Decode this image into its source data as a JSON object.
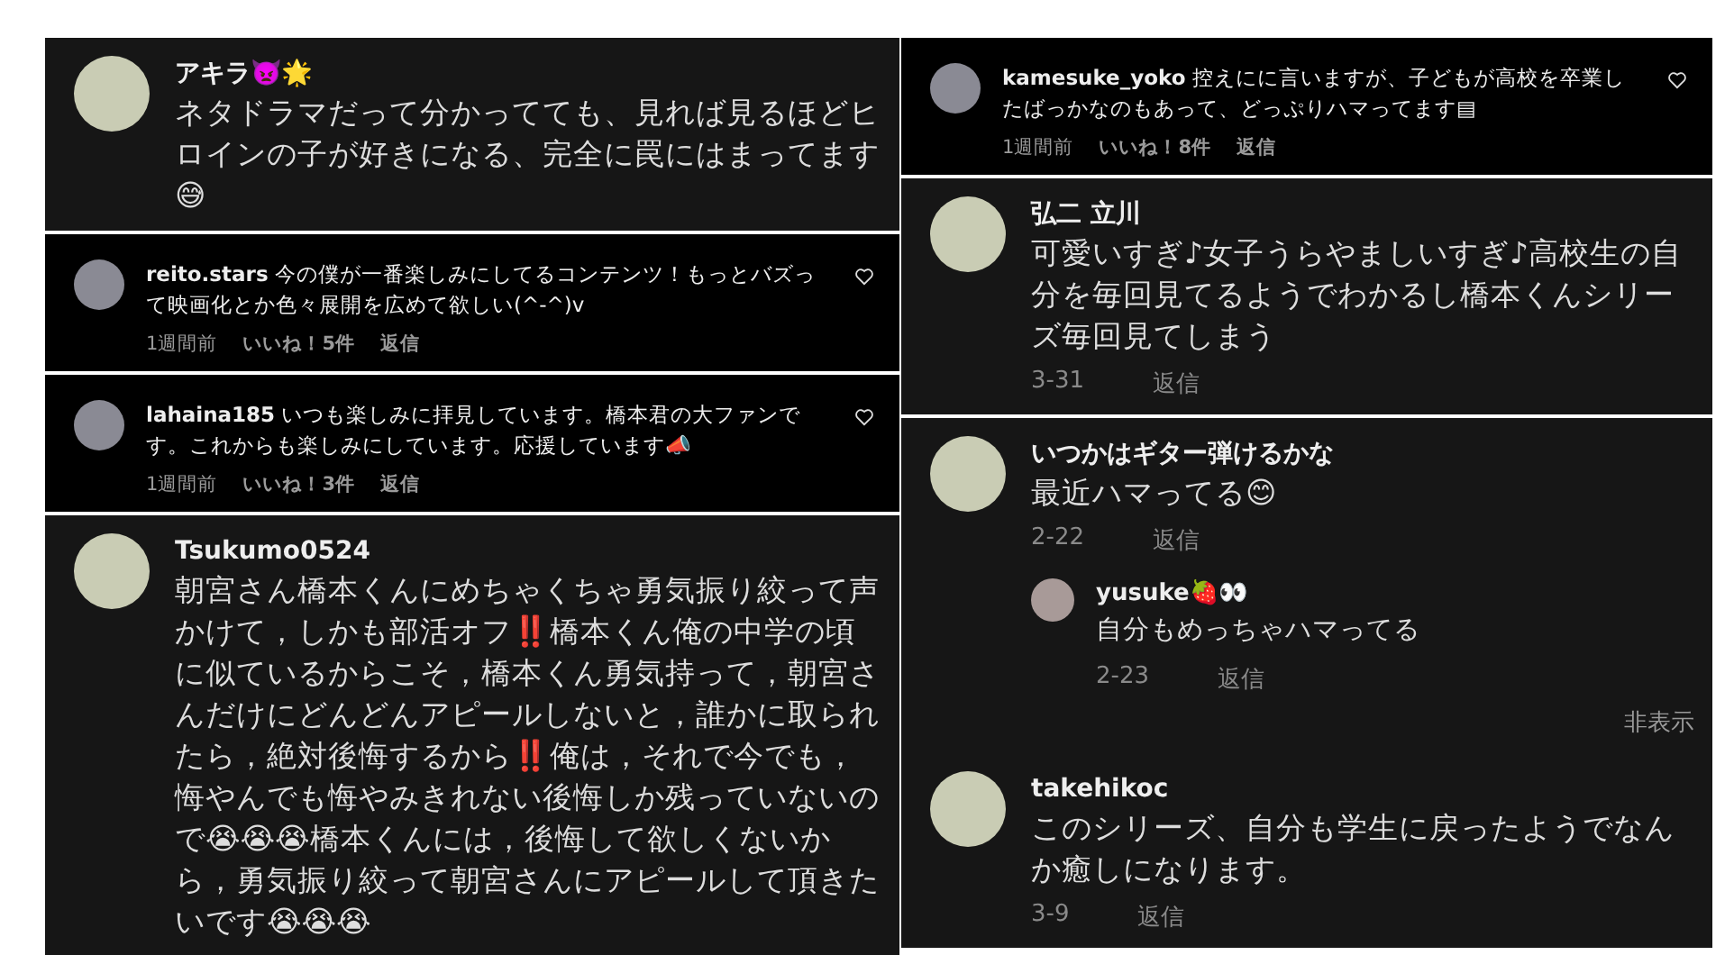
{
  "left_column": [
    {
      "kind": "full",
      "comments": [
        {
          "username": "アキラ👿🌟",
          "text": "ネタドラマだって分かってても、見れば見るほどヒロインの子が好きになる、完全に罠にはまってます😅"
        }
      ]
    },
    {
      "kind": "compact",
      "comments": [
        {
          "username": "reito.stars",
          "text": "今の僕が一番楽しみにしてるコンテンツ！もっとバズって映画化とか色々展開を広めて欲しい(^-^)v",
          "time": "1週間前",
          "likes": "いいね！5件",
          "reply_label": "返信"
        }
      ]
    },
    {
      "kind": "compact",
      "comments": [
        {
          "username": "lahaina185",
          "text": "いつも楽しみに拝見しています。橋本君の大ファンです。これからも楽しみにしています。応援しています📣",
          "time": "1週間前",
          "likes": "いいね！3件",
          "reply_label": "返信"
        }
      ]
    },
    {
      "kind": "full",
      "comments": [
        {
          "username": "Tsukumo0524",
          "text": "朝宮さん橋本くんにめちゃくちゃ勇気振り絞って声かけて，しかも部活オフ‼️橋本くん俺の中学の頃に似ているからこそ，橋本くん勇気持って，朝宮さんだけにどんどんアピールしないと，誰かに取られたら，絶対後悔するから‼️俺は，それで今でも，悔やんでも悔やみきれない後悔しか残っていないので😭😭😭橋本くんには，後悔して欲しくないから，勇気振り絞って朝宮さんにアピールして頂きたいです😭😭😭"
        }
      ]
    }
  ],
  "right_column": [
    {
      "kind": "compact",
      "comments": [
        {
          "username": "kamesuke_yoko",
          "text": "控えにに言いますが、子どもが高校を卒業したばっかなのもあって、どっぷりハマってます▤",
          "time": "1週間前",
          "likes": "いいね！8件",
          "reply_label": "返信"
        }
      ]
    },
    {
      "kind": "full",
      "comments": [
        {
          "username": "弘二 立川",
          "text": "可愛いすぎ♪女子うらやましいすぎ♪高校生の自分を毎回見てるようでわかるし橋本くんシリーズ毎回見てしまう",
          "time": "3-31",
          "reply_label": "返信"
        }
      ]
    },
    {
      "kind": "full",
      "comments": [
        {
          "username": "いつかはギター弾けるかな",
          "text": "最近ハマってる😊",
          "time": "2-22",
          "reply_label": "返信",
          "replies": [
            {
              "username": "yusuke🍓👀",
              "text": "自分もめっちゃハマってる",
              "time": "2-23",
              "reply_label": "返信"
            }
          ],
          "hide_label": "非表示"
        },
        {
          "username": "takehikoc",
          "text": "このシリーズ、自分も学生に戻ったようでなんか癒しになります。",
          "time": "3-9",
          "reply_label": "返信"
        }
      ]
    }
  ]
}
